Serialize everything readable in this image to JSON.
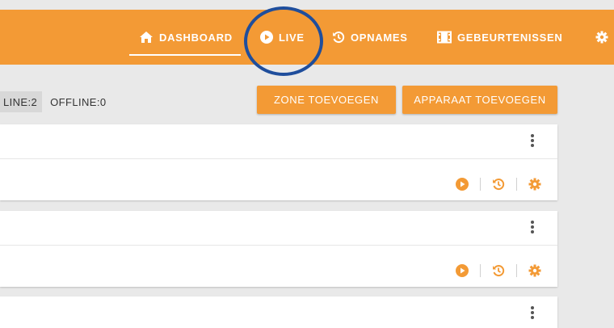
{
  "colors": {
    "brand": "#f39a35",
    "highlight_ring": "#1f4e9c",
    "background": "#e9e9e9"
  },
  "nav": {
    "items": [
      {
        "label": "DASHBOARD",
        "icon": "home-icon",
        "active": true
      },
      {
        "label": "LIVE",
        "icon": "play-circle-icon"
      },
      {
        "label": "OPNAMES",
        "icon": "history-icon"
      },
      {
        "label": "GEBEURTENISSEN",
        "icon": "film-icon"
      }
    ],
    "settings_icon": "gear-icon"
  },
  "status": {
    "online": "LINE:2",
    "offline": "OFFLINE:0"
  },
  "buttons": {
    "add_zone": "ZONE TOEVOEGEN",
    "add_device": "APPARAAT TOEVOEGEN"
  },
  "cards": [
    {
      "menu_icon": "more-vert-icon",
      "actions": [
        "play-circle-icon",
        "history-icon",
        "gear-icon"
      ]
    },
    {
      "menu_icon": "more-vert-icon",
      "actions": [
        "play-circle-icon",
        "history-icon",
        "gear-icon"
      ]
    },
    {
      "menu_icon": "more-vert-icon"
    }
  ]
}
